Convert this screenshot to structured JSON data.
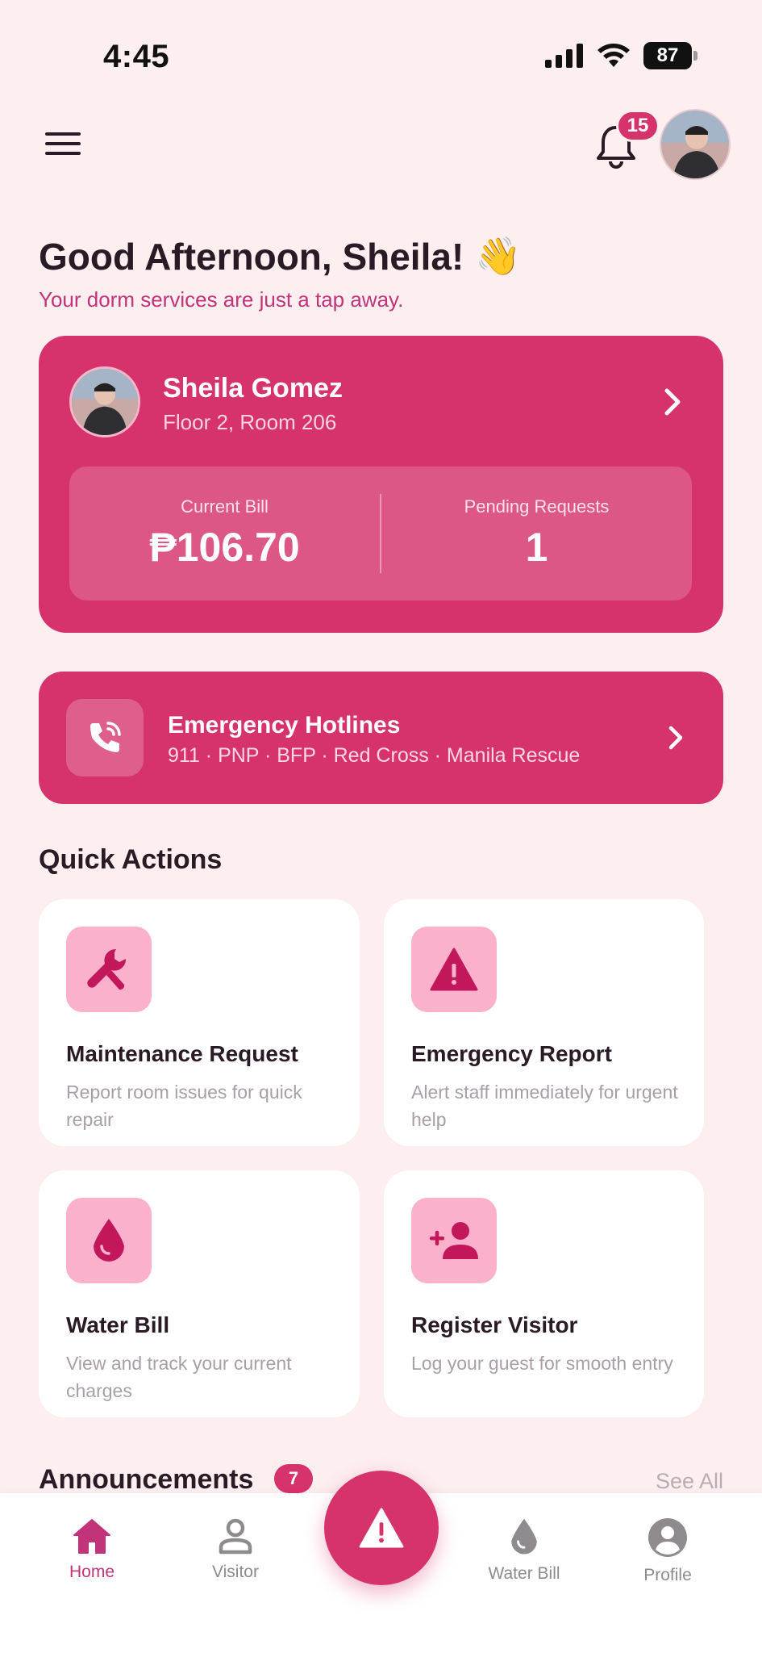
{
  "status_bar": {
    "time": "4:45",
    "battery": "87"
  },
  "header": {
    "notification_count": "15"
  },
  "greeting": {
    "title": "Good Afternoon, Sheila!",
    "emoji": "👋",
    "subtitle": "Your dorm services are just a tap away."
  },
  "profile_card": {
    "name": "Sheila Gomez",
    "room": "Floor 2, Room 206",
    "current_bill_label": "Current Bill",
    "current_bill_value": "₱106.70",
    "pending_label": "Pending Requests",
    "pending_value": "1"
  },
  "hotlines": {
    "title": "Emergency Hotlines",
    "numbers": "911 · PNP · BFP · Red Cross · Manila Rescue"
  },
  "quick_actions": {
    "title": "Quick Actions",
    "items": [
      {
        "title": "Maintenance Request",
        "desc": "Report room issues for quick repair",
        "icon": "wrench-icon"
      },
      {
        "title": "Emergency Report",
        "desc": "Alert staff immediately for urgent help",
        "icon": "warning-icon"
      },
      {
        "title": "Water Bill",
        "desc": "View and track your current charges",
        "icon": "water-drop-icon"
      },
      {
        "title": "Register Visitor",
        "desc": "Log your guest for smooth entry",
        "icon": "add-person-icon"
      }
    ]
  },
  "announcements": {
    "title": "Announcements",
    "count": "7",
    "see_all": "See All"
  },
  "bottom_nav": {
    "items": [
      {
        "label": "Home",
        "icon": "home-icon",
        "active": true
      },
      {
        "label": "Visitor",
        "icon": "person-icon",
        "active": false
      },
      {
        "label": "Water Bill",
        "icon": "water-drop-icon",
        "active": false
      },
      {
        "label": "Profile",
        "icon": "profile-icon",
        "active": false
      }
    ],
    "fab_icon": "warning-icon"
  },
  "colors": {
    "accent": "#d6336c",
    "background": "#fdeef0",
    "icon_tile": "#fbb1cc"
  }
}
